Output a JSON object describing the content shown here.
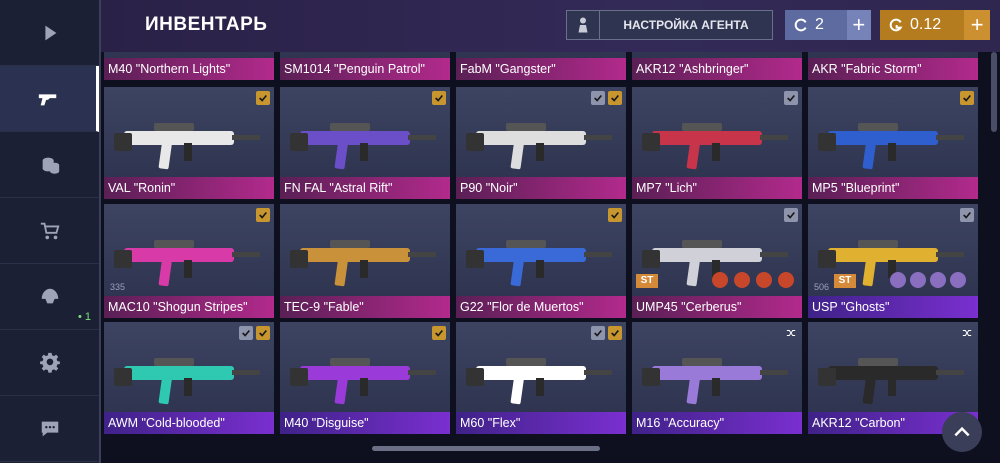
{
  "header": {
    "title": "ИНВЕНТАРЬ",
    "agent_button": "НАСТРОЙКА АГЕНТА",
    "silver": {
      "value": "2",
      "plus": "+"
    },
    "gold": {
      "value": "0.12",
      "plus": "+"
    }
  },
  "sidebar": {
    "items": [
      "play-icon",
      "gun-icon",
      "coins-icon",
      "cart-icon",
      "helmet-icon",
      "gear-icon",
      "chat-icon"
    ],
    "clan_badge": "• 1"
  },
  "inventory": {
    "row0": [
      "M40 \"Northern Lights\"",
      "SM1014 \"Penguin Patrol\"",
      "FabM \"Gangster\"",
      "AKR12 \"Ashbringer\"",
      "AKR \"Fabric Storm\""
    ],
    "row1": [
      "VAL \"Ronin\"",
      "FN FAL \"Astral Rift\"",
      "P90 \"Noir\"",
      "MP7 \"Lich\"",
      "MP5 \"Blueprint\""
    ],
    "row2": [
      "MAC10 \"Shogun Stripes\"",
      "TEC-9 \"Fable\"",
      "G22 \"Flor de Muertos\"",
      "UMP45 \"Cerberus\"",
      "USP \"Ghosts\""
    ],
    "row3": [
      "AWM \"Cold-blooded\"",
      "M40 \"Disguise\"",
      "M60 \"Flex\"",
      "M16 \"Accuracy\"",
      "AKR12 \"Carbon\""
    ],
    "mac10_count": "335",
    "usp_count": "506",
    "st_label": "ST"
  },
  "colors": {
    "pink": "#b22a8c",
    "purple": "#7a2fd0",
    "gold": "#c8962e",
    "accent_silver": "#5d6ba0"
  }
}
